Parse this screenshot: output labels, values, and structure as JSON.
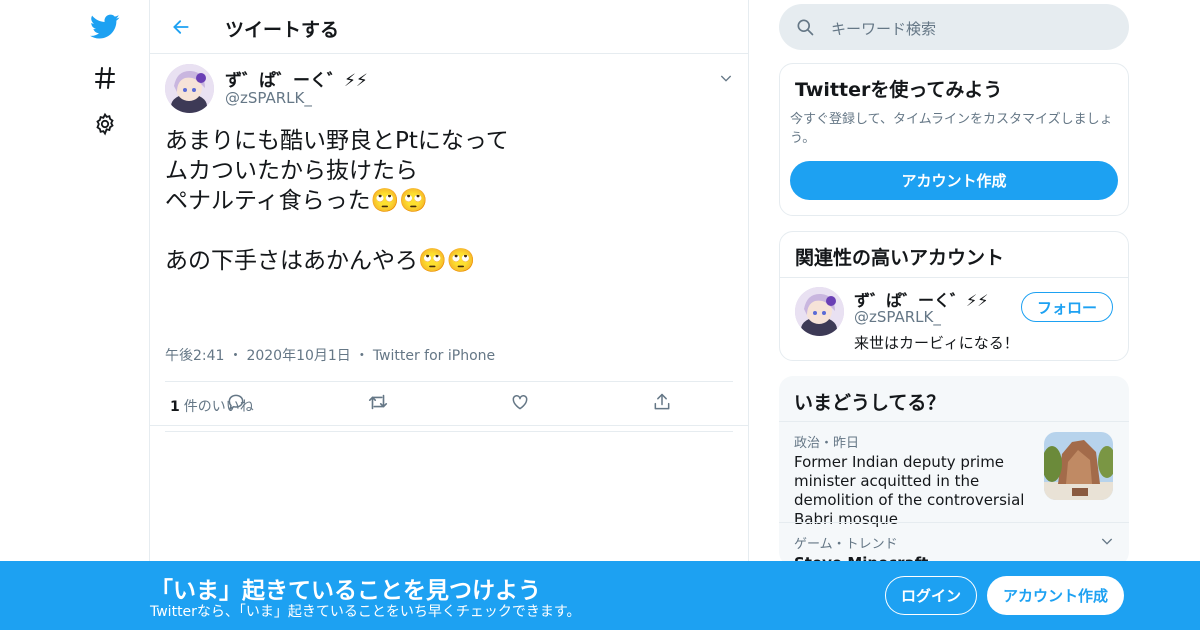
{
  "header": {
    "title": "ツイートする"
  },
  "tweet": {
    "display_name": "ず゛ぱ゛ーく゛⚡⚡",
    "handle": "@zSPARLK_",
    "text": "あまりにも酷い野良とPtになって\nムカついたから抜けたら\nペナルティ食らった🙄🙄\n\nあの下手さはあかんやろ🙄🙄",
    "time": "午後2:41",
    "date": "2020年10月1日",
    "source": "Twitter for iPhone",
    "sep": "・",
    "like_count": "1",
    "like_label": "件のいいね"
  },
  "search": {
    "placeholder": "キーワード検索"
  },
  "signup_card": {
    "title": "Twitterを使ってみよう",
    "description": "今すぐ登録して、タイムラインをカスタマイズしましょう。",
    "button": "アカウント作成"
  },
  "related": {
    "title": "関連性の高いアカウント",
    "name": "ず゛ぱ゛ーく゛⚡⚡",
    "handle": "@zSPARLK_",
    "bio": "来世はカービィになる！",
    "follow": "フォロー"
  },
  "trends": {
    "title": "いまどうしてる？",
    "item1_meta": "政治・昨日",
    "item1_text": "Former Indian deputy prime minister acquitted in the demolition of the controversial Babri mosque",
    "item2_meta": "ゲーム・トレンド",
    "item2_text": "Steve Minecraft"
  },
  "banner": {
    "title": "「いま」起きていることを見つけよう",
    "subtitle": "Twitterなら、「いま」起きていることをいち早くチェックできます。",
    "login": "ログイン",
    "signup": "アカウント作成"
  },
  "colors": {
    "accent": "#1da1f2",
    "muted": "#657786",
    "border": "#e6ecf0"
  }
}
